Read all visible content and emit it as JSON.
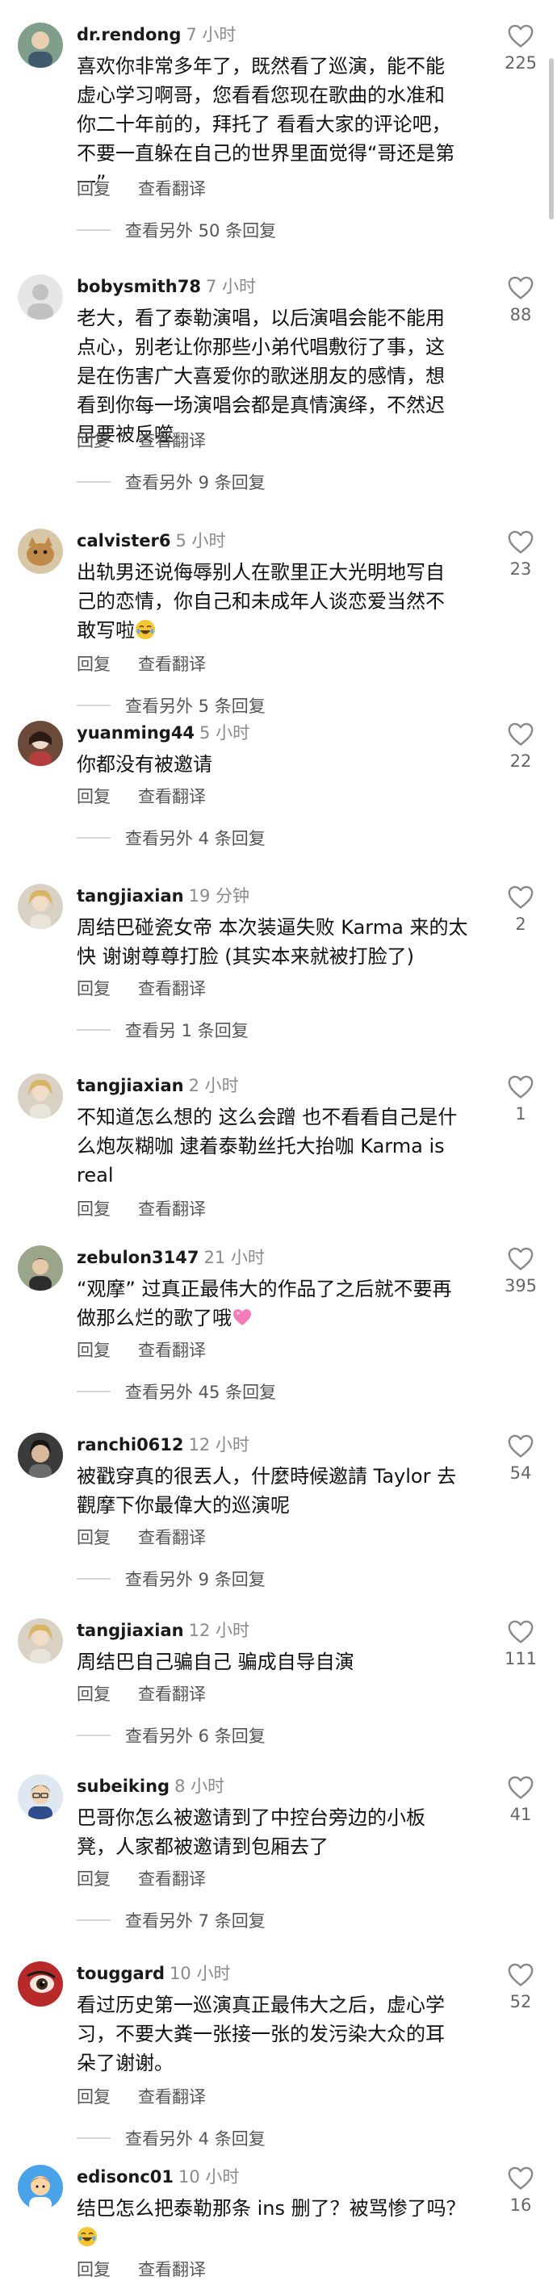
{
  "actions": {
    "reply_label": "回复",
    "translate_label": "查看翻译"
  },
  "comments": [
    {
      "username": "dr.rendong",
      "time": "7 小时",
      "text": "喜欢你非常多年了，既然看了巡演，能不能\n虚心学习啊哥，您看看您现在歌曲的水准和\n你二十年前的，拜托了 看看大家的评论吧，\n不要一直躲在自己的世界里面觉得“哥还是第\n一”",
      "likes": "225",
      "view_replies": "查看另外 50 条回复"
    },
    {
      "username": "bobysmith78",
      "time": "7 小时",
      "text": "老大，看了泰勒演唱，以后演唱会能不能用\n点心，别老让你那些小弟代唱敷衍了事，这\n是在伤害广大喜爱你的歌迷朋友的感情，想\n看到你每一场演唱会都是真情演绎，不然迟\n早要被反噬",
      "likes": "88",
      "view_replies": "查看另外 9 条回复"
    },
    {
      "username": "calvister6",
      "time": "5 小时",
      "text": "出轨男还说侮辱别人在歌里正大光明地写自\n己的恋情，你自己和未成年人谈恋爱当然不\n敢写啦",
      "emoji": "😂",
      "likes": "23",
      "view_replies": "查看另外 5 条回复"
    },
    {
      "username": "yuanming44",
      "time": "5 小时",
      "text": "你都没有被邀请",
      "likes": "22",
      "view_replies": "查看另外 4 条回复"
    },
    {
      "username": "tangjiaxian",
      "time": "19 分钟",
      "text": "周结巴碰瓷女帝 本次装逼失败 Karma 来的太\n快 谢谢尊尊打脸 (其实本来就被打脸了)",
      "likes": "2",
      "view_replies": "查看另 1 条回复"
    },
    {
      "username": "tangjiaxian",
      "time": "2 小时",
      "text": "不知道怎么想的 这么会蹭 也不看看自己是什\n么炮灰糊咖 逮着泰勒丝托大抬咖 Karma is\nreal",
      "likes": "1"
    },
    {
      "username": "zebulon3147",
      "time": "21 小时",
      "text": "“观摩” 过真正最伟大的作品了之后就不要再\n做那么烂的歌了哦",
      "emoji": "💗",
      "likes": "395",
      "view_replies": "查看另外 45 条回复"
    },
    {
      "username": "ranchi0612",
      "time": "12 小时",
      "text": "被戳穿真的很丟人，什麼時候邀請 Taylor 去\n觀摩下你最偉大的巡演呢",
      "likes": "54",
      "view_replies": "查看另外 9 条回复"
    },
    {
      "username": "tangjiaxian",
      "time": "12 小时",
      "text": "周结巴自己骗自己 骗成自导自演",
      "likes": "111",
      "view_replies": "查看另外 6 条回复"
    },
    {
      "username": "subeiking",
      "time": "8 小时",
      "text": "巴哥你怎么被邀请到了中控台旁边的小板\n凳，人家都被邀请到包厢去了",
      "likes": "41",
      "view_replies": "查看另外 7 条回复"
    },
    {
      "username": "touggard",
      "time": "10 小时",
      "text": "看过历史第一巡演真正最伟大之后，虚心学\n习，不要大粪一张接一张的发污染大众的耳\n朵了谢谢。",
      "likes": "52",
      "view_replies": "查看另外 4 条回复"
    },
    {
      "username": "edisonc01",
      "time": "10 小时",
      "text": "结巴怎么把泰勒那条 ins 删了？被骂惨了吗？",
      "emoji": "😂",
      "likes": "16"
    }
  ]
}
